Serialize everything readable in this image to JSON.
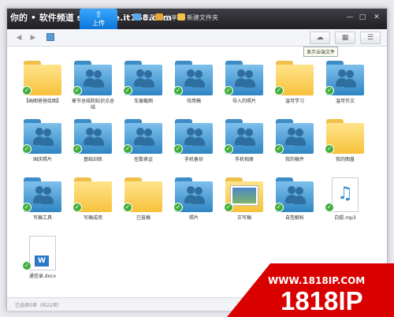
{
  "watermark": "你的 • 软件频道 software.it168.com",
  "toolbar": {
    "upload_tab": "上传",
    "items": [
      {
        "label": "查看",
        "icon": "eye-icon"
      },
      {
        "label": "分享",
        "icon": "share-icon"
      },
      {
        "label": "新建文件夹",
        "icon": "new-folder-icon"
      }
    ]
  },
  "tooltip": "显示云端文件",
  "items": [
    {
      "label": "【画图爸爸给图】",
      "kind": "plain"
    },
    {
      "label": "章节总结和知识点总结",
      "kind": "shared"
    },
    {
      "label": "车展截图",
      "kind": "shared"
    },
    {
      "label": "待用稿",
      "kind": "shared"
    },
    {
      "label": "导入的照片",
      "kind": "shared"
    },
    {
      "label": "温可学习",
      "kind": "plain"
    },
    {
      "label": "温可作文",
      "kind": "shared"
    },
    {
      "label": "国庆照片",
      "kind": "shared"
    },
    {
      "label": "基础训练",
      "kind": "shared"
    },
    {
      "label": "任数表证",
      "kind": "shared"
    },
    {
      "label": "手机备份",
      "kind": "shared"
    },
    {
      "label": "手机相册",
      "kind": "shared"
    },
    {
      "label": "我的稿件",
      "kind": "shared"
    },
    {
      "label": "我的图盘",
      "kind": "plain"
    },
    {
      "label": "写稿工具",
      "kind": "shared"
    },
    {
      "label": "写稿成用",
      "kind": "plain"
    },
    {
      "label": "已投稿",
      "kind": "plain"
    },
    {
      "label": "照片",
      "kind": "shared"
    },
    {
      "label": "正写稿",
      "kind": "pics"
    },
    {
      "label": "自签解析",
      "kind": "shared"
    },
    {
      "label": "白狐.mp3",
      "kind": "music"
    },
    {
      "label": "通信录.docx",
      "kind": "word"
    }
  ],
  "status": "已选择0项（共22项）",
  "brand": {
    "url": "WWW.1818IP.COM",
    "name": "1818IP"
  },
  "colors": {
    "accent": "#1a86e0",
    "sync_check": "#3fae3c",
    "brand_red": "#d90000"
  }
}
